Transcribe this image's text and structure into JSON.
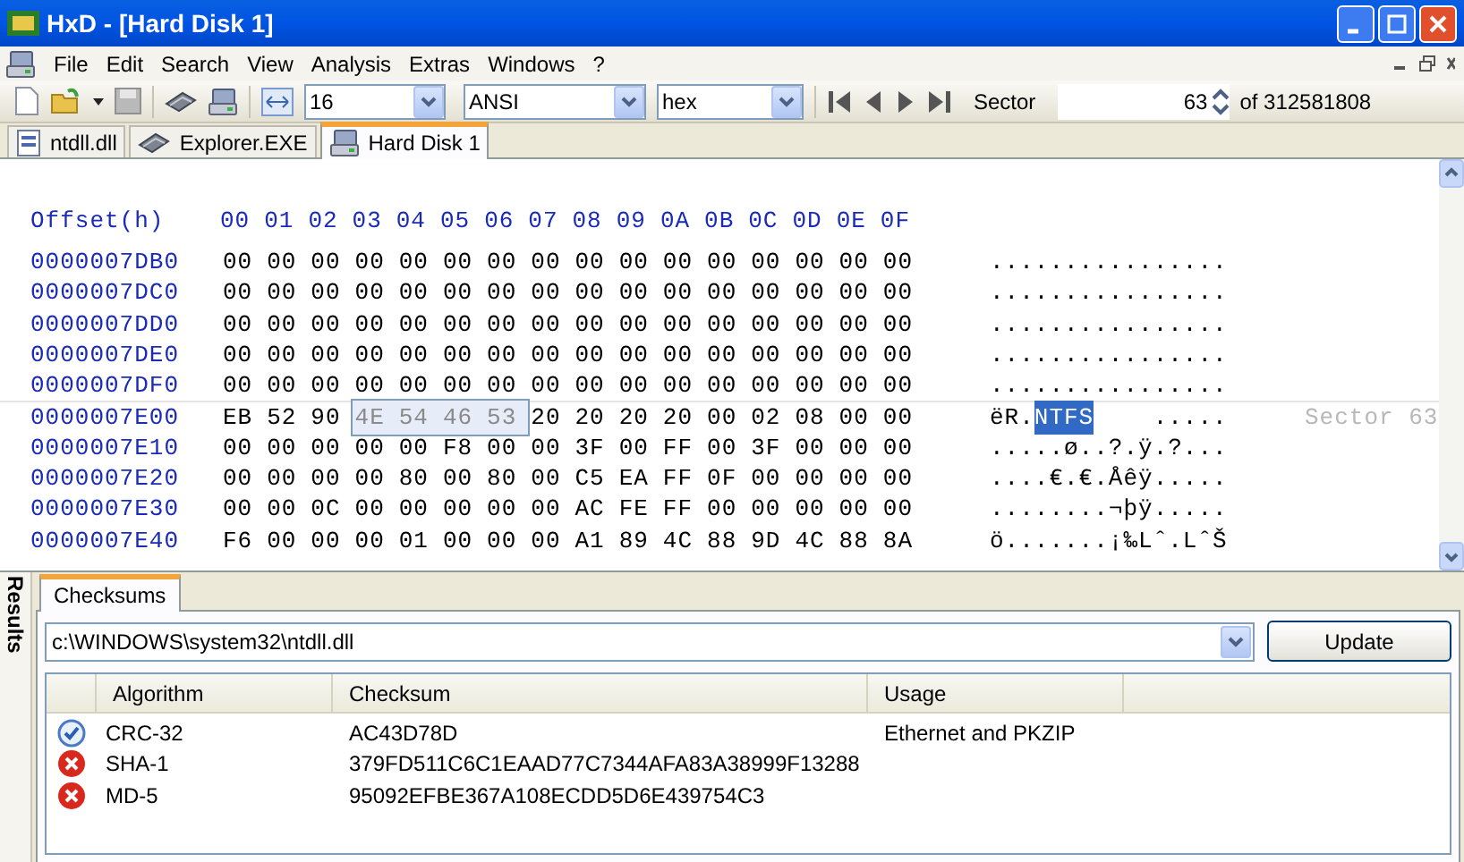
{
  "window": {
    "title": "HxD - [Hard Disk 1]"
  },
  "menu": [
    "File",
    "Edit",
    "Search",
    "View",
    "Analysis",
    "Extras",
    "Windows",
    "?"
  ],
  "toolbar": {
    "bytes_per_row": "16",
    "charset": "ANSI",
    "offset_base": "hex",
    "sector_label": "Sector",
    "sector_value": "63",
    "sector_total": "of 312581808"
  },
  "tabs": [
    {
      "label": "ntdll.dll",
      "selected": false,
      "kind": "file"
    },
    {
      "label": "Explorer.EXE",
      "selected": false,
      "kind": "memory"
    },
    {
      "label": "Hard Disk 1",
      "selected": true,
      "kind": "disk"
    }
  ],
  "hex_view": {
    "offset_label": "Offset(h)",
    "columns": [
      "00",
      "01",
      "02",
      "03",
      "04",
      "05",
      "06",
      "07",
      "08",
      "09",
      "0A",
      "0B",
      "0C",
      "0D",
      "0E",
      "0F"
    ],
    "rows": [
      {
        "offset": "0000007DB0",
        "sector_boundary": false,
        "segments": [
          {
            "selected": false,
            "bytes": [
              "00",
              "00",
              "00",
              "00",
              "00",
              "00",
              "00",
              "00",
              "00",
              "00",
              "00",
              "00",
              "00",
              "00",
              "00",
              "00"
            ]
          }
        ],
        "text": [
          {
            "value": "................",
            "selected": false
          }
        ]
      },
      {
        "offset": "0000007DC0",
        "sector_boundary": false,
        "segments": [
          {
            "selected": false,
            "bytes": [
              "00",
              "00",
              "00",
              "00",
              "00",
              "00",
              "00",
              "00",
              "00",
              "00",
              "00",
              "00",
              "00",
              "00",
              "00",
              "00"
            ]
          }
        ],
        "text": [
          {
            "value": "................",
            "selected": false
          }
        ]
      },
      {
        "offset": "0000007DD0",
        "sector_boundary": false,
        "segments": [
          {
            "selected": false,
            "bytes": [
              "00",
              "00",
              "00",
              "00",
              "00",
              "00",
              "00",
              "00",
              "00",
              "00",
              "00",
              "00",
              "00",
              "00",
              "00",
              "00"
            ]
          }
        ],
        "text": [
          {
            "value": "................",
            "selected": false
          }
        ]
      },
      {
        "offset": "0000007DE0",
        "sector_boundary": false,
        "segments": [
          {
            "selected": false,
            "bytes": [
              "00",
              "00",
              "00",
              "00",
              "00",
              "00",
              "00",
              "00",
              "00",
              "00",
              "00",
              "00",
              "00",
              "00",
              "00",
              "00"
            ]
          }
        ],
        "text": [
          {
            "value": "................",
            "selected": false
          }
        ]
      },
      {
        "offset": "0000007DF0",
        "sector_boundary": false,
        "segments": [
          {
            "selected": false,
            "bytes": [
              "00",
              "00",
              "00",
              "00",
              "00",
              "00",
              "00",
              "00",
              "00",
              "00",
              "00",
              "00",
              "00",
              "00",
              "00",
              "00"
            ]
          }
        ],
        "text": [
          {
            "value": "................",
            "selected": false
          }
        ]
      },
      {
        "offset": "0000007E00",
        "sector_boundary": true,
        "note": "Sector 63",
        "segments": [
          {
            "selected": false,
            "bytes": [
              "EB",
              "52",
              "90"
            ]
          },
          {
            "selected": true,
            "bytes": [
              "4E",
              "54",
              "46",
              "53"
            ]
          },
          {
            "selected": false,
            "bytes": [
              "20",
              "20",
              "20",
              "20",
              "00",
              "02",
              "08",
              "00",
              "00"
            ]
          }
        ],
        "text": [
          {
            "value": "ëR.",
            "selected": false
          },
          {
            "value": "NTFS",
            "selected": true
          },
          {
            "value": "    .....",
            "selected": false
          }
        ]
      },
      {
        "offset": "0000007E10",
        "sector_boundary": false,
        "segments": [
          {
            "selected": false,
            "bytes": [
              "00",
              "00",
              "00",
              "00",
              "00",
              "F8",
              "00",
              "00",
              "3F",
              "00",
              "FF",
              "00",
              "3F",
              "00",
              "00",
              "00"
            ]
          }
        ],
        "text": [
          {
            "value": ".....ø..?.ÿ.?...",
            "selected": false
          }
        ]
      },
      {
        "offset": "0000007E20",
        "sector_boundary": false,
        "segments": [
          {
            "selected": false,
            "bytes": [
              "00",
              "00",
              "00",
              "00",
              "80",
              "00",
              "80",
              "00",
              "C5",
              "EA",
              "FF",
              "0F",
              "00",
              "00",
              "00",
              "00"
            ]
          }
        ],
        "text": [
          {
            "value": "....€.€.Åêÿ.....",
            "selected": false
          }
        ]
      },
      {
        "offset": "0000007E30",
        "sector_boundary": false,
        "segments": [
          {
            "selected": false,
            "bytes": [
              "00",
              "00",
              "0C",
              "00",
              "00",
              "00",
              "00",
              "00",
              "AC",
              "FE",
              "FF",
              "00",
              "00",
              "00",
              "00",
              "00"
            ]
          }
        ],
        "text": [
          {
            "value": "........¬þÿ.....",
            "selected": false
          }
        ]
      },
      {
        "offset": "0000007E40",
        "sector_boundary": false,
        "segments": [
          {
            "selected": false,
            "bytes": [
              "F6",
              "00",
              "00",
              "00",
              "01",
              "00",
              "00",
              "00",
              "A1",
              "89",
              "4C",
              "88",
              "9D",
              "4C",
              "88",
              "8A"
            ]
          }
        ],
        "text": [
          {
            "value": "ö.......¡‰Lˆ.LˆŠ",
            "selected": false
          }
        ]
      }
    ]
  },
  "results": {
    "side_tab": "Results",
    "tabs": [
      {
        "label": "Checksums",
        "selected": true
      }
    ],
    "file": "c:\\WINDOWS\\system32\\ntdll.dll",
    "update_button": "Update",
    "columns": [
      "Algorithm",
      "Checksum",
      "Usage"
    ],
    "rows": [
      {
        "kind": "ok",
        "algorithm": "CRC-32",
        "checksum": "AC43D78D",
        "usage": "Ethernet and PKZIP"
      },
      {
        "kind": "error",
        "algorithm": "SHA-1",
        "checksum": "379FD511C6C1EAAD77C7344AFA83A38999F13288"
      },
      {
        "kind": "error",
        "algorithm": "MD-5",
        "checksum": "95092EFBE367A108ECDD5D6E439754C3"
      }
    ]
  }
}
